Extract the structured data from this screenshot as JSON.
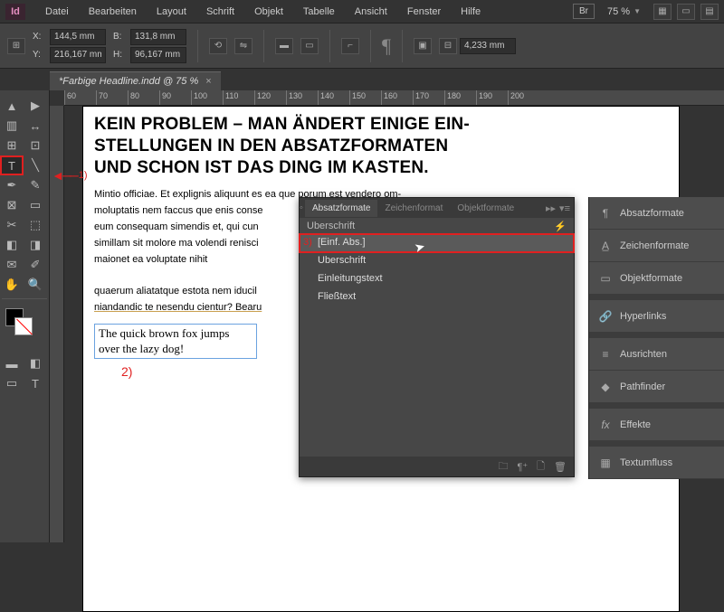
{
  "app": {
    "logo": "Id"
  },
  "menu": [
    "Datei",
    "Bearbeiten",
    "Layout",
    "Schrift",
    "Objekt",
    "Tabelle",
    "Ansicht",
    "Fenster",
    "Hilfe"
  ],
  "topright": {
    "br": "Br",
    "zoom": "75 %"
  },
  "options": {
    "x": "144,5 mm",
    "y": "216,167 mm",
    "b": "131,8 mm",
    "h": "96,167 mm",
    "stroke": "4,233 mm"
  },
  "docTab": {
    "title": "*Farbige Headline.indd @ 75 %",
    "close": "×"
  },
  "ruler": [
    "60",
    "70",
    "80",
    "90",
    "100",
    "110",
    "120",
    "130",
    "140",
    "150",
    "160",
    "170",
    "180",
    "190",
    "200"
  ],
  "page": {
    "headline": "KEIN PROBLEM – MAN ÄNDERT EINIGE EIN-\nSTELLUNGEN IN DEN ABSATZFORMATEN\nUND SCHON IST DAS DING IM KASTEN.",
    "body1": "Mintio officiae. Et explignis aliquunt es ea que porum est vendero om-\nmoluptatis nem faccus que enis conse",
    "body2": "eum consequam simendis et, qui cun",
    "body3": "simillam sit molore ma volendi renisci",
    "body4": "maionet ea voluptate nihit",
    "body5": "quaerum aliatatque estota nem iducil",
    "body6": "niandandic te nesendu cientur? Bearu",
    "sample": "The quick brown fox jumps\nover the lazy dog!",
    "ann2": "2)"
  },
  "ann1": "1)",
  "panel": {
    "tabs": [
      "Absatzformate",
      "Zeichenformat",
      "Objektformate"
    ],
    "sub": "Uberschrift",
    "items": [
      "[Einf. Abs.]",
      "Uberschrift",
      "Einleitungstext",
      "Fließtext"
    ]
  },
  "dock": [
    {
      "icon": "¶",
      "label": "Absatzformate"
    },
    {
      "icon": "A̲",
      "label": "Zeichenformate"
    },
    {
      "icon": "▭",
      "label": "Objektformate"
    },
    {
      "sep": true
    },
    {
      "icon": "🔗",
      "label": "Hyperlinks"
    },
    {
      "sep": true
    },
    {
      "icon": "≡",
      "label": "Ausrichten"
    },
    {
      "icon": "◆",
      "label": "Pathfinder"
    },
    {
      "sep": true
    },
    {
      "icon": "fx",
      "label": "Effekte"
    },
    {
      "sep": true
    },
    {
      "icon": "▦",
      "label": "Textumfluss"
    }
  ]
}
